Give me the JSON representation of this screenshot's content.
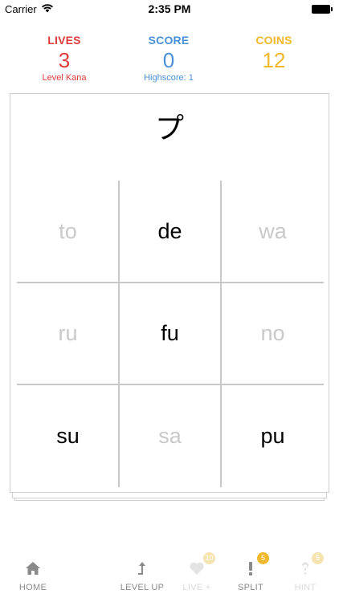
{
  "status_bar": {
    "carrier": "Carrier",
    "time": "2:35 PM"
  },
  "stats": {
    "lives": {
      "label": "LIVES",
      "value": "3",
      "sub": "Level Kana",
      "color": "#e03b3b"
    },
    "score": {
      "label": "SCORE",
      "value": "0",
      "sub": "Highscore: 1",
      "color": "#4a90d9"
    },
    "coins": {
      "label": "COINS",
      "value": "12",
      "color": "#f0b82a"
    }
  },
  "card": {
    "kana": "プ",
    "options": [
      {
        "text": "to",
        "active": false
      },
      {
        "text": "de",
        "active": true
      },
      {
        "text": "wa",
        "active": false
      },
      {
        "text": "ru",
        "active": false
      },
      {
        "text": "fu",
        "active": true
      },
      {
        "text": "no",
        "active": false
      },
      {
        "text": "su",
        "active": true
      },
      {
        "text": "sa",
        "active": false
      },
      {
        "text": "pu",
        "active": true
      }
    ]
  },
  "toolbar": {
    "home": {
      "label": "HOME",
      "icon": "home-icon",
      "enabled": true
    },
    "level_up": {
      "label": "LEVEL UP",
      "icon": "level-up-icon",
      "enabled": true
    },
    "live_plus": {
      "label": "LIVE +",
      "icon": "heart-icon",
      "enabled": false,
      "badge": "10"
    },
    "split": {
      "label": "SPLIT",
      "icon": "exclamation-icon",
      "enabled": true,
      "badge": "5"
    },
    "hint": {
      "label": "HINT",
      "icon": "question-icon",
      "enabled": false,
      "badge": "5"
    }
  }
}
